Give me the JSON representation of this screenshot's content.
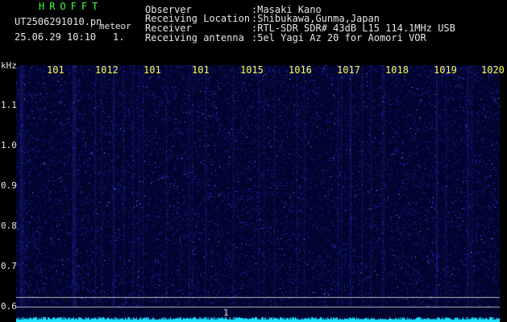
{
  "header": {
    "app_title": "HROFFT",
    "file_name": "UT2506291010.pn",
    "file_suffix": "meteor",
    "datetime": "25.06.29 10:10",
    "frame_no": "1."
  },
  "info": [
    {
      "label": "Observer",
      "value": ":Masaki Kano"
    },
    {
      "label": "Receiving Location",
      "value": ":Shibukawa,Gunma,Japan"
    },
    {
      "label": "Receiver",
      "value": ":RTL-SDR SDR# 43dB L15 114.1MHz USB"
    },
    {
      "label": "Receiving antenna",
      "value": ":5el Yagi Az 20 for Aomori VOR"
    }
  ],
  "plot": {
    "y_unit": "kHz",
    "y_ticks": [
      "1.1",
      "1.0",
      "0.9",
      "0.8",
      "0.7",
      "0.6"
    ],
    "x_ticks": [
      "101",
      "1012",
      "101",
      "101",
      "1015",
      "1016",
      "1017",
      "1018",
      "1019",
      "1020"
    ],
    "marker": "1",
    "colors": {
      "background": "#020430",
      "noise": "#2a3cff",
      "baseline": "#1ee0ff",
      "xtick": "#ffff44",
      "title": "#3cff3c"
    }
  }
}
